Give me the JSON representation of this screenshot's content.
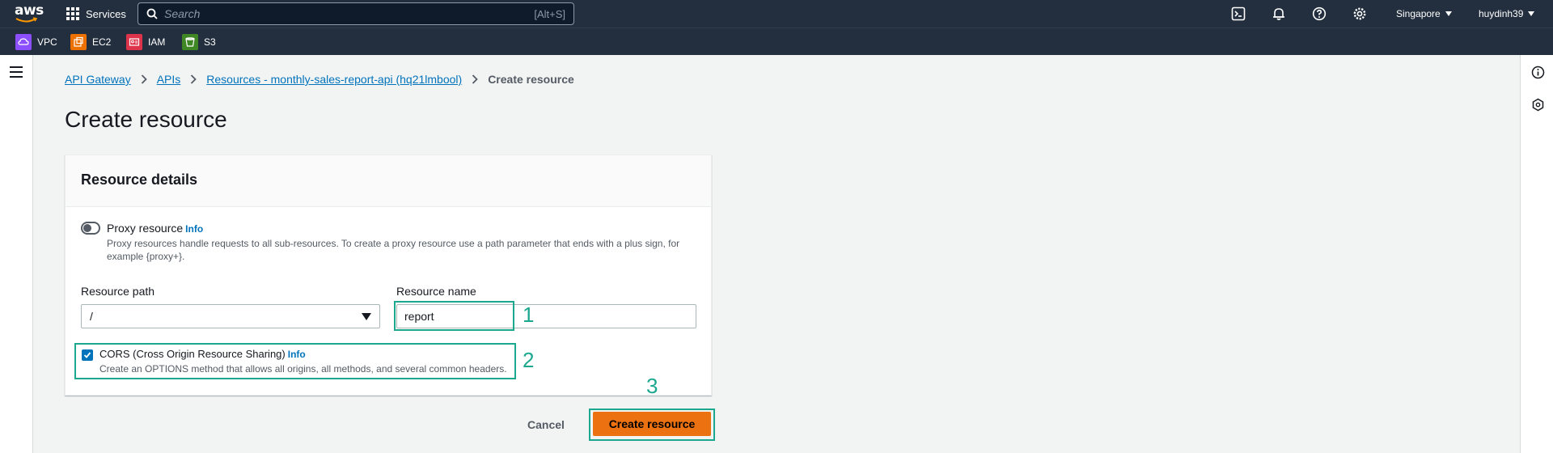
{
  "topnav": {
    "logo_text": "aws",
    "services_label": "Services",
    "search_placeholder": "Search",
    "search_shortcut": "[Alt+S]",
    "region": "Singapore",
    "user": "huydinh39"
  },
  "favorites": [
    {
      "label": "VPC",
      "color": "#8c4fff"
    },
    {
      "label": "EC2",
      "color": "#ed7100"
    },
    {
      "label": "IAM",
      "color": "#dd344c"
    },
    {
      "label": "S3",
      "color": "#3f8624"
    }
  ],
  "breadcrumb": {
    "items": [
      "API Gateway",
      "APIs",
      "Resources - monthly-sales-report-api (hq21lmbool)"
    ],
    "current": "Create resource"
  },
  "page_title": "Create resource",
  "form": {
    "section_title": "Resource details",
    "proxy": {
      "label": "Proxy resource",
      "info": "Info",
      "description": "Proxy resources handle requests to all sub-resources. To create a proxy resource use a path parameter that ends with a plus sign, for example {proxy+}.",
      "enabled": false
    },
    "resource_path": {
      "label": "Resource path",
      "value": "/"
    },
    "resource_name": {
      "label": "Resource name",
      "value": "report"
    },
    "cors": {
      "label": "CORS (Cross Origin Resource Sharing)",
      "info": "Info",
      "description": "Create an OPTIONS method that allows all origins, all methods, and several common headers.",
      "checked": true
    },
    "cancel_label": "Cancel",
    "submit_label": "Create resource"
  },
  "annotations": [
    "1",
    "2",
    "3"
  ],
  "colors": {
    "nav_bg": "#232f3e",
    "primary_button": "#ec7211",
    "link": "#0073bb",
    "annotation": "#1ca78f"
  }
}
